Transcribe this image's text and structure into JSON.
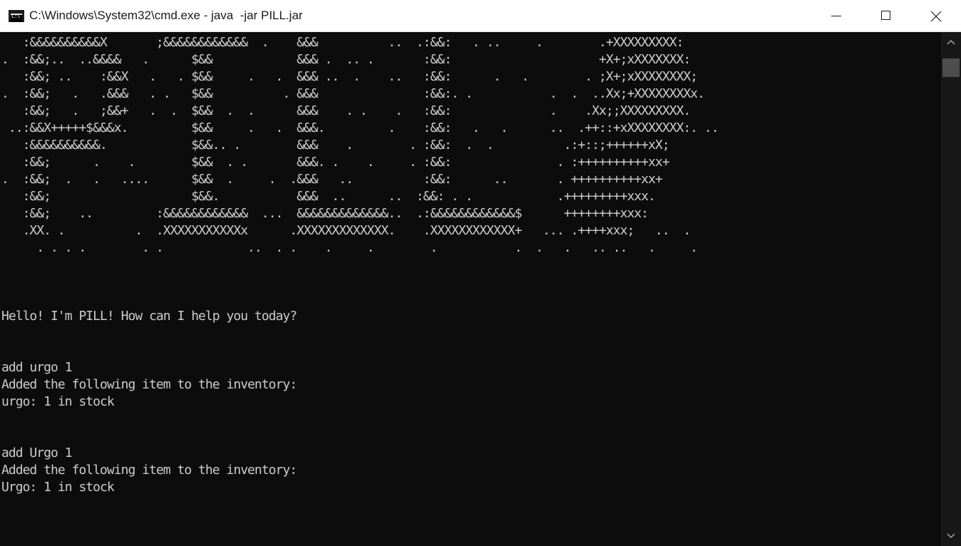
{
  "window": {
    "title": "C:\\Windows\\System32\\cmd.exe - java  -jar PILL.jar",
    "icon": "cmd-icon",
    "controls": {
      "minimize": "minimize-icon",
      "maximize": "maximize-icon",
      "close": "close-icon"
    }
  },
  "console": {
    "ascii_art": [
      "   :&&&&&&&&&&X       ;&&&&&&&&&&&&  .    &&&          ..  .:&&:   . ..     .        .+XXXXXXXXX:",
      ".  :&&;..  ..&&&&   .      $&&            &&& .  .. .       :&&:                     +X+;xXXXXXXX:",
      "   :&&; ..    :&&X   .   . $&&     .   .  &&& ..  .    ..   :&&:      .   .        . ;X+;xXXXXXXXX;",
      ".  :&&;   .   .&&&   . .   $&&          . &&&               :&&:. .           .  .  ..Xx;+XXXXXXXXx.",
      "   :&&;   .   ;&&+   .  .  $&&  .  .      &&&    . .    .   :&&:              .    .Xx;;XXXXXXXXX.",
      " ..:&&X+++++$&&&x.         $&&     .   .  &&&.         .    :&&:   .   .      ..  .++::+xXXXXXXXX:. ..",
      "   :&&&&&&&&&&.            $&&.. .        &&&    .        . :&&:  .  .          .:+::;++++++xX;",
      "   :&&;      .    .        $&&  . .       &&&. .    .     . :&&:               . :++++++++++xx+",
      ".  :&&;  .   .   ....      $&&  .     .  .&&&   ..          :&&:      ..       . ++++++++++xx+",
      "   :&&;                    $&&.           &&&  ..      ..  :&&: . .            .+++++++++xxx.",
      "   :&&;    ..         :&&&&&&&&&&&&  ...  &&&&&&&&&&&&&..  .:&&&&&&&&&&&&$      ++++++++xxx:",
      "   .XX. .          .  .XXXXXXXXXXXx      .XXXXXXXXXXXXX.    .XXXXXXXXXXXX+   ... .++++xxx;   ..  .",
      "     . . . .        . .            ..  . .    .     .        .           .  .   .   .. ..   .     ."
    ],
    "lines": [
      "",
      "",
      "",
      "Hello! I'm PILL! How can I help you today?",
      "",
      "",
      "add urgo 1",
      "Added the following item to the inventory:",
      "urgo: 1 in stock",
      "",
      "",
      "add Urgo 1",
      "Added the following item to the inventory:",
      "Urgo: 1 in stock"
    ]
  },
  "colors": {
    "console_bg": "#0c0c0c",
    "console_fg": "#cccccc",
    "titlebar_bg": "#ffffff",
    "scrollbar_bg": "#171717",
    "scroll_thumb": "#4d4d4d"
  }
}
